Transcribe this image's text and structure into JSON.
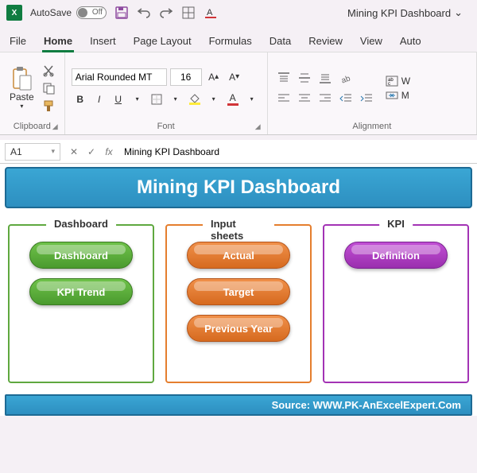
{
  "titlebar": {
    "autosave_label": "AutoSave",
    "autosave_state": "Off",
    "file_title": "Mining KPI Dashboard"
  },
  "tabs": {
    "file": "File",
    "home": "Home",
    "insert": "Insert",
    "page_layout": "Page Layout",
    "formulas": "Formulas",
    "data": "Data",
    "review": "Review",
    "view": "View",
    "automate": "Auto"
  },
  "ribbon": {
    "clipboard": {
      "paste": "Paste",
      "label": "Clipboard"
    },
    "font": {
      "name": "Arial Rounded MT",
      "size": "16",
      "bold": "B",
      "italic": "I",
      "underline": "U",
      "increase": "A",
      "decrease": "A",
      "label": "Font"
    },
    "alignment": {
      "wrap": "W",
      "merge": "M",
      "label": "Alignment"
    }
  },
  "formula_bar": {
    "name_box": "A1",
    "fx_label": "fx",
    "value": "Mining KPI Dashboard"
  },
  "worksheet": {
    "banner": "Mining KPI Dashboard",
    "groups": {
      "dashboard": {
        "title": "Dashboard",
        "btn1": "Dashboard",
        "btn2": "KPI Trend"
      },
      "input": {
        "title": "Input sheets",
        "btn1": "Actual",
        "btn2": "Target",
        "btn3": "Previous Year"
      },
      "kpi": {
        "title": "KPI",
        "btn1": "Definition"
      }
    },
    "source": "Source: WWW.PK-AnExcelExpert.Com"
  }
}
